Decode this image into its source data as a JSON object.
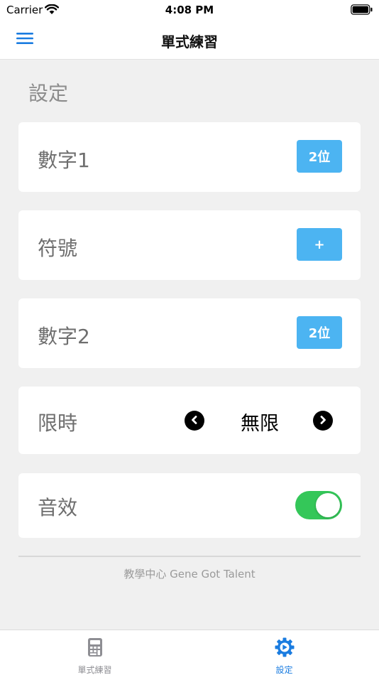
{
  "status_bar": {
    "carrier": "Carrier",
    "time": "4:08 PM"
  },
  "nav": {
    "title": "單式練習",
    "menu_icon": "hamburger-menu-icon"
  },
  "settings": {
    "section_title": "設定",
    "rows": [
      {
        "label": "數字1",
        "value": "2位"
      },
      {
        "label": "符號",
        "value": "+"
      },
      {
        "label": "數字2",
        "value": "2位"
      }
    ],
    "time_limit": {
      "label": "限時",
      "value": "無限",
      "prev_icon": "chevron-left-circle-icon",
      "next_icon": "chevron-right-circle-icon"
    },
    "sound": {
      "label": "音效",
      "enabled": true
    }
  },
  "footer": {
    "text": "教學中心 Gene Got Talent"
  },
  "tab_bar": {
    "tabs": [
      {
        "label": "單式練習",
        "icon": "calculator-icon",
        "selected": false
      },
      {
        "label": "設定",
        "icon": "gear-icon",
        "selected": true
      }
    ]
  },
  "colors": {
    "accent": "#1a7ce0",
    "button": "#4cb4f2",
    "toggle_on": "#34c759",
    "background": "#f0f0f0"
  }
}
